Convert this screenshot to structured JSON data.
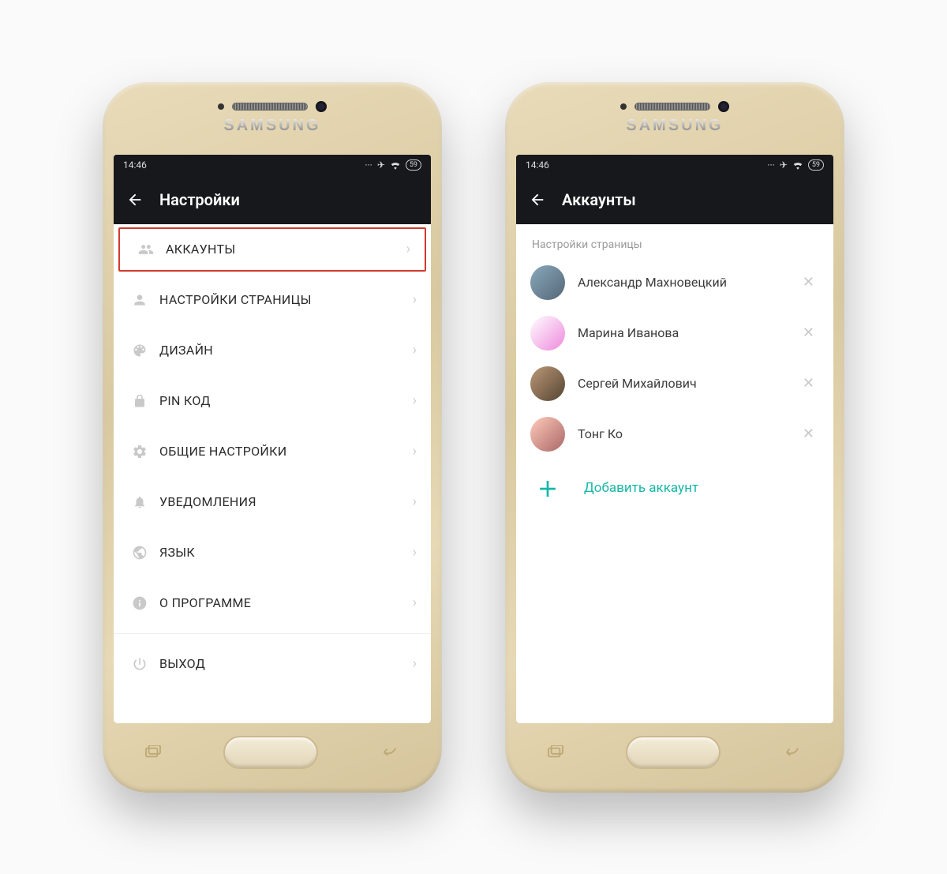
{
  "device": {
    "brand": "SAMSUNG"
  },
  "status": {
    "time": "14:46",
    "battery": "59"
  },
  "screen1": {
    "title": "Настройки",
    "items": [
      {
        "icon": "people-icon",
        "label": "АККАУНТЫ",
        "highlighted": true
      },
      {
        "icon": "person-icon",
        "label": "НАСТРОЙКИ СТРАНИЦЫ"
      },
      {
        "icon": "palette-icon",
        "label": "ДИЗАЙН"
      },
      {
        "icon": "lock-icon",
        "label": "PIN КОД"
      },
      {
        "icon": "gear-icon",
        "label": "ОБЩИЕ НАСТРОЙКИ"
      },
      {
        "icon": "bell-icon",
        "label": "УВЕДОМЛЕНИЯ"
      },
      {
        "icon": "globe-icon",
        "label": "ЯЗЫК"
      },
      {
        "icon": "info-icon",
        "label": "О ПРОГРАММЕ"
      }
    ],
    "footer_item": {
      "icon": "power-icon",
      "label": "ВЫХОД"
    }
  },
  "screen2": {
    "title": "Аккаунты",
    "section_header": "Настройки страницы",
    "accounts": [
      {
        "name": "Александр Махновецкий"
      },
      {
        "name": "Марина Иванова"
      },
      {
        "name": "Сергей Михайлович"
      },
      {
        "name": "Тонг Ко"
      }
    ],
    "add_label": "Добавить аккаунт"
  },
  "colors": {
    "accent": "#17b7a6",
    "highlight_border": "#d23a2e"
  }
}
